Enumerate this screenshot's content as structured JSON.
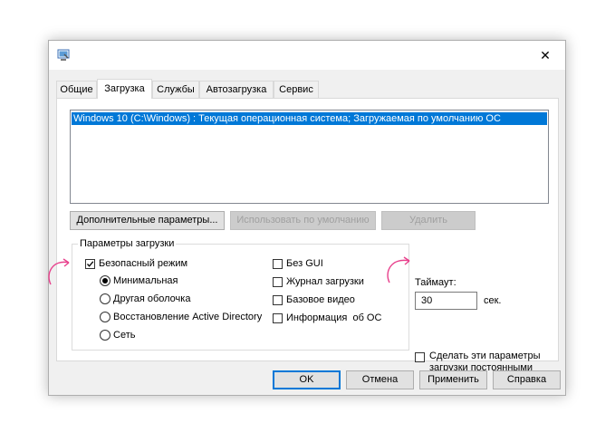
{
  "window": {
    "close_glyph": "✕"
  },
  "tabs": [
    {
      "label": "Общие"
    },
    {
      "label": "Загрузка"
    },
    {
      "label": "Службы"
    },
    {
      "label": "Автозагрузка"
    },
    {
      "label": "Сервис"
    }
  ],
  "active_tab": "Загрузка",
  "boot_list": {
    "items": [
      "Windows 10 (C:\\Windows) : Текущая операционная система; Загружаемая по умолчанию ОС"
    ],
    "selected_index": 0
  },
  "buttons": {
    "advanced": "Дополнительные параметры...",
    "set_default": "Использовать по умолчанию",
    "delete": "Удалить"
  },
  "boot_options": {
    "title": "Параметры загрузки",
    "safe_boot": {
      "label": "Безопасный режим",
      "checked": true
    },
    "radios": [
      {
        "label": "Минимальная",
        "selected": true
      },
      {
        "label": "Другая оболочка",
        "selected": false
      },
      {
        "label": "Восстановление Active Directory",
        "selected": false
      },
      {
        "label": "Сеть",
        "selected": false
      }
    ],
    "right_checkboxes": [
      {
        "label": "Без GUI",
        "checked": false
      },
      {
        "label": "Журнал загрузки",
        "checked": false
      },
      {
        "label": "Базовое видео",
        "checked": false
      },
      {
        "label": "Информация  об ОС",
        "checked": false
      }
    ]
  },
  "timeout": {
    "label": "Таймаут:",
    "value": "30",
    "unit": "сек."
  },
  "permanent": {
    "line1": "Сделать эти параметры",
    "line2": "загрузки постоянными",
    "checked": false
  },
  "footer": {
    "ok": "OK",
    "cancel": "Отмена",
    "apply": "Применить",
    "help": "Справка"
  },
  "colors": {
    "selection": "#0078d7",
    "annotation_arrow": "#e8408c"
  }
}
